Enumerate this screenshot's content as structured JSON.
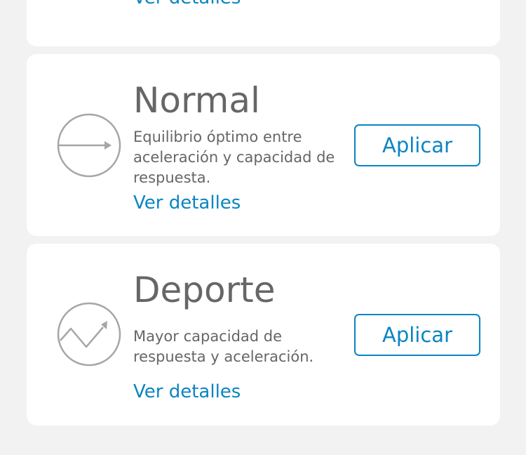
{
  "top_card": {
    "details_link": "Ver detalles"
  },
  "modes": [
    {
      "title": "Normal",
      "description": "Equilibrio óptimo entre aceleración y capacidad de respuesta.",
      "details_link": "Ver detalles",
      "apply_label": "Aplicar",
      "icon": "arrow-right-circle-icon"
    },
    {
      "title": "Deporte",
      "description": "Mayor capacidad de respuesta y aceleración.",
      "details_link": "Ver detalles",
      "apply_label": "Aplicar",
      "icon": "zigzag-arrow-circle-icon"
    }
  ],
  "colors": {
    "background": "#f2f2f2",
    "card": "#ffffff",
    "accent": "#0a85c2",
    "text": "#666666",
    "icon": "#a6a6a6"
  }
}
